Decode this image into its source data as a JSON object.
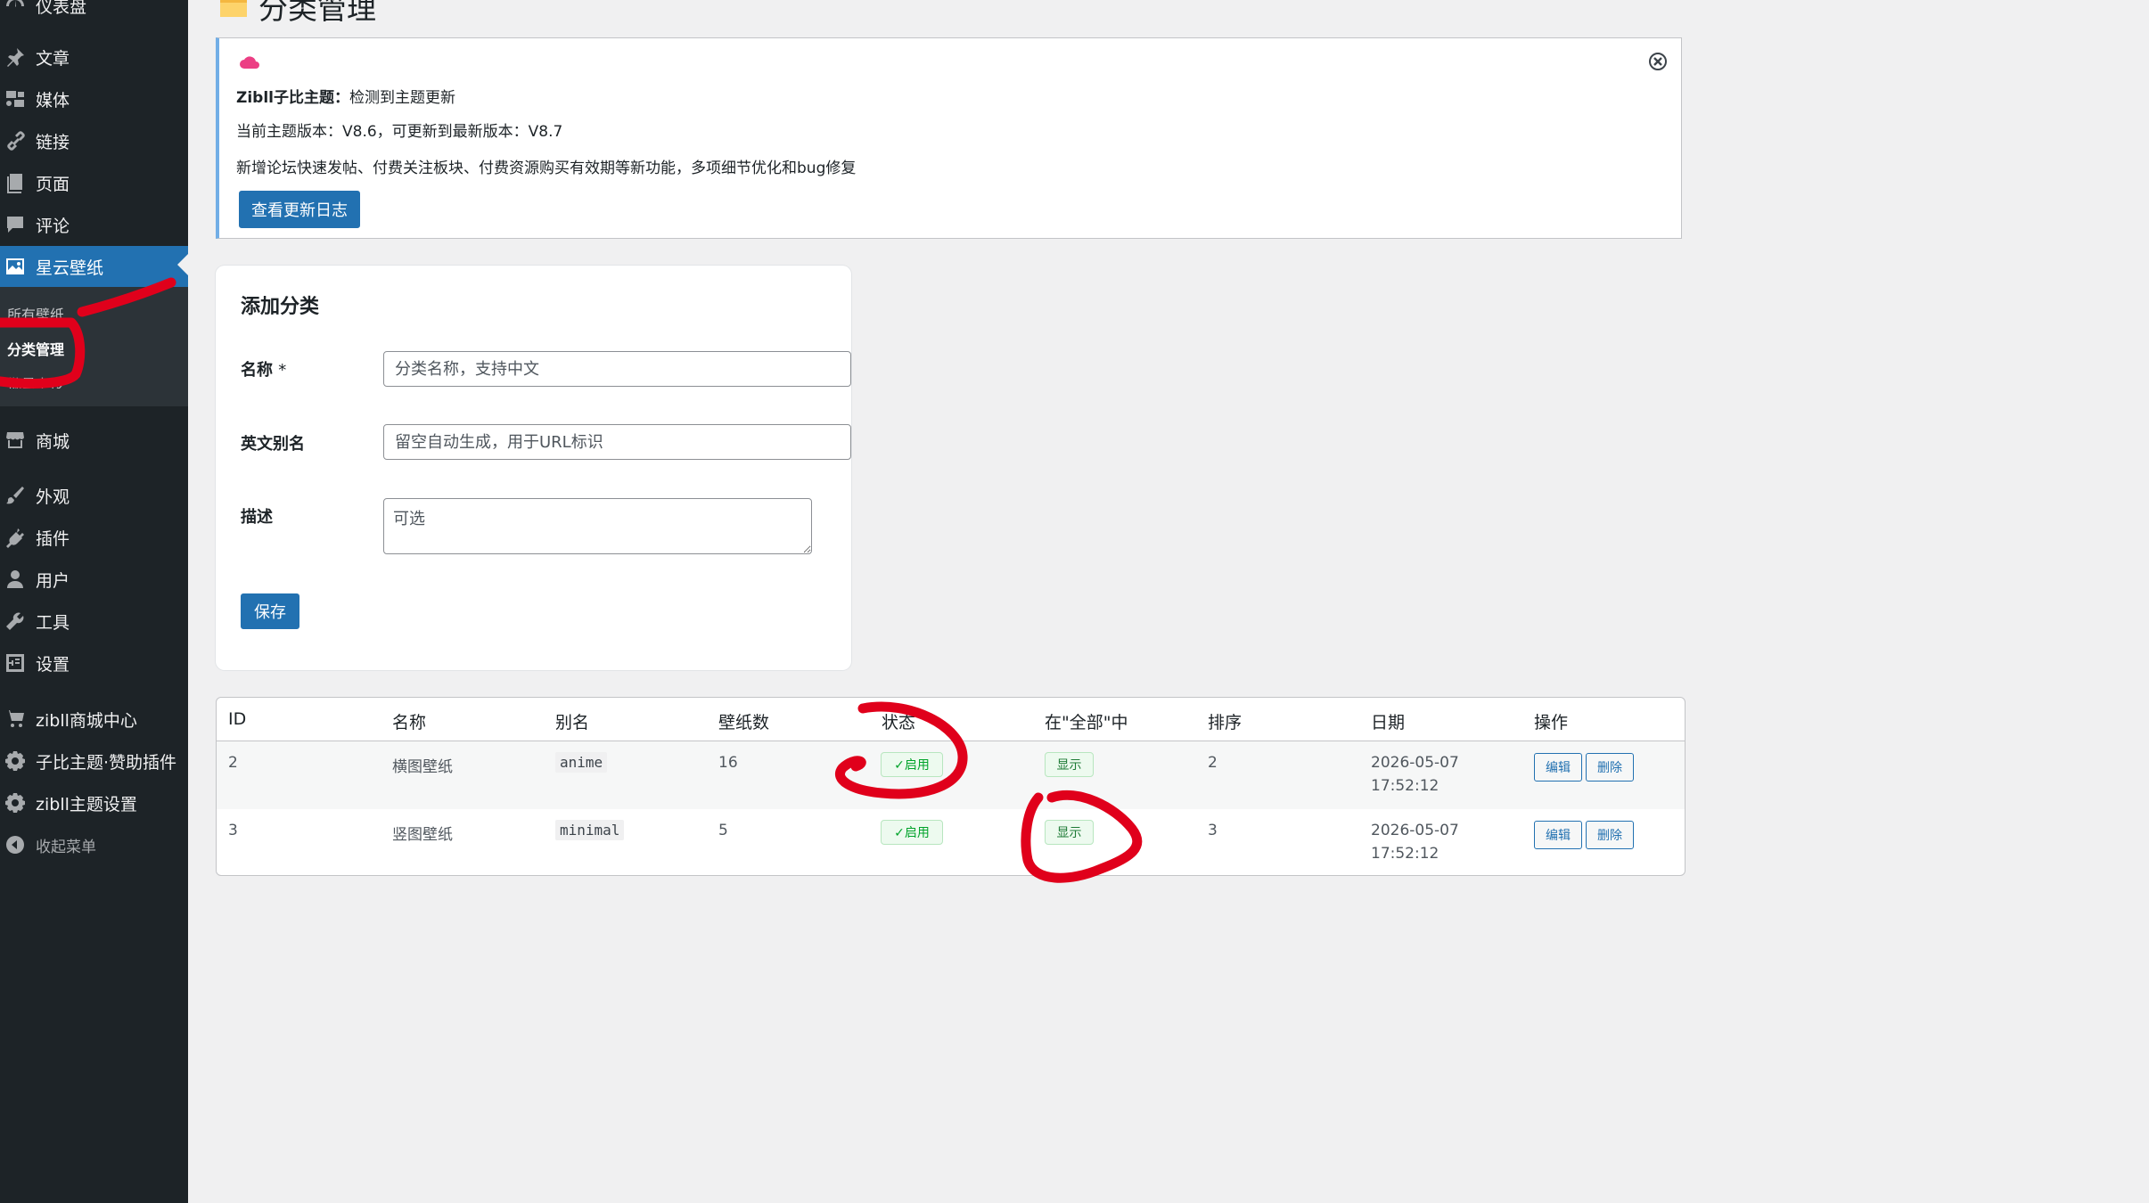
{
  "sidebar": {
    "items": [
      {
        "label": "仪表盘",
        "icon": "dashboard-icon"
      },
      {
        "label": "文章",
        "icon": "pin-icon"
      },
      {
        "label": "媒体",
        "icon": "media-icon"
      },
      {
        "label": "链接",
        "icon": "link-icon"
      },
      {
        "label": "页面",
        "icon": "page-icon"
      },
      {
        "label": "评论",
        "icon": "comment-icon"
      },
      {
        "label": "星云壁纸",
        "icon": "wallpaper-icon",
        "active": true
      },
      {
        "label": "商城",
        "icon": "store-icon"
      },
      {
        "label": "外观",
        "icon": "brush-icon"
      },
      {
        "label": "插件",
        "icon": "plugin-icon"
      },
      {
        "label": "用户",
        "icon": "user-icon"
      },
      {
        "label": "工具",
        "icon": "wrench-icon"
      },
      {
        "label": "设置",
        "icon": "settings-icon"
      },
      {
        "label": "zibll商城中心",
        "icon": "cart-icon"
      },
      {
        "label": "子比主题·赞助插件",
        "icon": "gear-icon"
      },
      {
        "label": "zibll主题设置",
        "icon": "gear-icon"
      },
      {
        "label": "收起菜单",
        "icon": "collapse-icon"
      }
    ],
    "submenu": [
      {
        "label": "所有壁纸"
      },
      {
        "label": "分类管理",
        "current": true
      },
      {
        "label": "批量上传"
      }
    ]
  },
  "page": {
    "title": "分类管理",
    "title_icon": "folder-icon"
  },
  "notice": {
    "icon": "cloud-icon",
    "line1_bold": "Zibll子比主题：",
    "line1_text": "检测到主题更新",
    "line2": "当前主题版本：V8.6，可更新到最新版本：V8.7",
    "line3": "新增论坛快速发帖、付费关注板块、付费资源购买有效期等新功能，多项细节优化和bug修复",
    "button": "查看更新日志",
    "close_icon": "close-circle-icon"
  },
  "form": {
    "title": "添加分类",
    "name_label": "名称",
    "required_mark": "*",
    "name_placeholder": "分类名称，支持中文",
    "slug_label": "英文别名",
    "slug_placeholder": "留空自动生成，用于URL标识",
    "desc_label": "描述",
    "desc_placeholder": "可选",
    "save_button": "保存"
  },
  "table": {
    "headers": [
      "ID",
      "名称",
      "别名",
      "壁纸数",
      "状态",
      "在\"全部\"中",
      "排序",
      "日期",
      "操作"
    ],
    "rows": [
      {
        "id": "2",
        "name": "横图壁纸",
        "slug": "anime",
        "count": "16",
        "status": "✓启用",
        "in_all": "显示",
        "order": "2",
        "date": "2026-05-07",
        "time": "17:52:12",
        "edit": "编辑",
        "delete": "删除"
      },
      {
        "id": "3",
        "name": "竖图壁纸",
        "slug": "minimal",
        "count": "5",
        "status": "✓启用",
        "in_all": "显示",
        "order": "3",
        "date": "2026-05-07",
        "time": "17:52:12",
        "edit": "编辑",
        "delete": "删除"
      }
    ]
  },
  "colors": {
    "sidebar_bg": "#1d2327",
    "accent": "#2271b1",
    "annotation": "#e0001b",
    "badge_green": "#00a32a"
  }
}
